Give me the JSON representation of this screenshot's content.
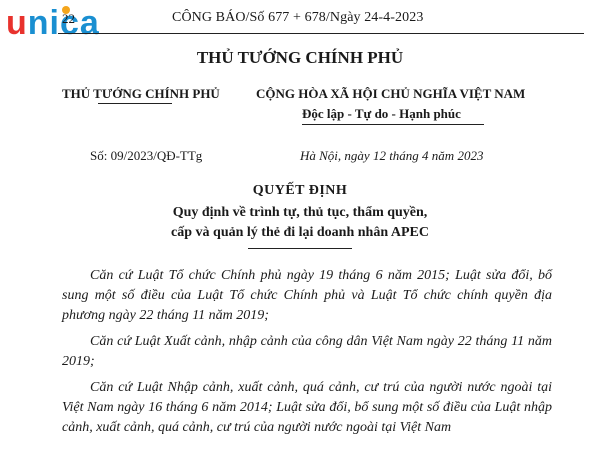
{
  "logo": {
    "brand_first": "u",
    "brand_rest": "nica",
    "colors": {
      "red": "#e8322d",
      "blue": "#1a8fd1",
      "dot": "#f4a51c"
    }
  },
  "header": {
    "page_number": "22",
    "gazette_line": "CÔNG BÁO/Số 677 + 678/Ngày 24-4-2023"
  },
  "issuer_title": "THỦ TƯỚNG CHÍNH PHỦ",
  "left_block": {
    "issuer": "THỦ TƯỚNG CHÍNH PHỦ",
    "doc_number": "Số: 09/2023/QĐ-TTg"
  },
  "right_block": {
    "country": "CỘNG HÒA XÃ HỘI CHỦ NGHĨA VIỆT NAM",
    "motto": "Độc lập - Tự do - Hạnh phúc",
    "place_date": "Hà Nội, ngày 12 tháng 4 năm 2023"
  },
  "decision": {
    "title": "QUYẾT ĐỊNH",
    "subject_line1": "Quy định về trình tự, thủ tục, thẩm quyền,",
    "subject_line2": "cấp và quản lý thẻ đi lại doanh nhân APEC"
  },
  "paragraphs": [
    "Căn cứ Luật Tổ chức Chính phủ ngày 19 tháng 6 năm 2015; Luật sửa đổi, bổ sung một số điều của Luật Tổ chức Chính phủ và Luật Tổ chức chính quyền địa phương ngày 22 tháng 11 năm 2019;",
    "Căn cứ Luật Xuất cảnh, nhập cảnh của công dân Việt Nam ngày 22 tháng 11 năm 2019;",
    "Căn cứ Luật Nhập cảnh, xuất cảnh, quá cảnh, cư trú của người nước ngoài tại Việt Nam ngày 16 tháng 6 năm 2014; Luật sửa đổi, bổ sung một số điều của Luật nhập cảnh, xuất cảnh, quá cảnh, cư trú của người nước ngoài tại Việt Nam"
  ]
}
